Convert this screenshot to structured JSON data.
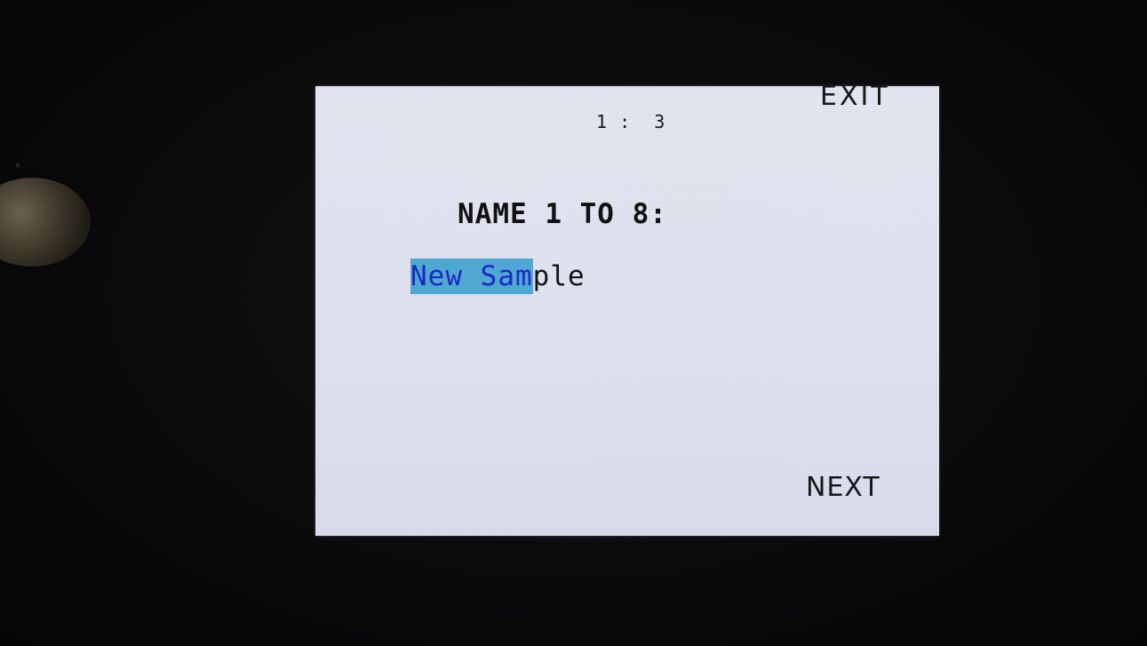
{
  "screen": {
    "page_indicator": "1 :  3",
    "exit_label": "EXIT",
    "prompt": "NAME 1 TO 8:",
    "name_input": {
      "selected_text": "New Sam",
      "remaining_text": "ple"
    },
    "next_label": "NEXT"
  },
  "colors": {
    "screen_background": "#e4e6f1",
    "selection_highlight": "#4ea8d2",
    "selected_text": "#1c28c4",
    "text": "#111114"
  }
}
